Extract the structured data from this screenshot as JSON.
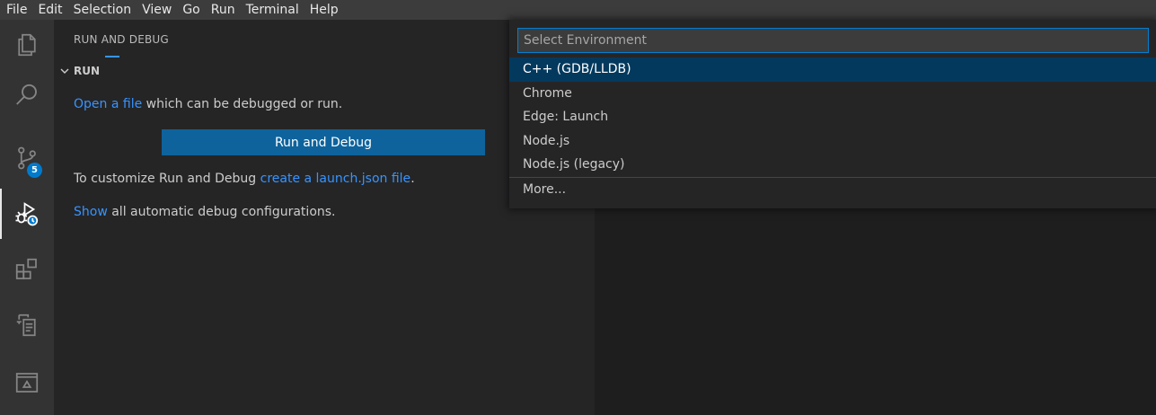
{
  "menubar": [
    "File",
    "Edit",
    "Selection",
    "View",
    "Go",
    "Run",
    "Terminal",
    "Help"
  ],
  "activitybar": {
    "items": [
      {
        "name": "explorer",
        "icon": "files-icon"
      },
      {
        "name": "search",
        "icon": "search-icon"
      },
      {
        "name": "source-control",
        "icon": "source-control-icon",
        "badge": "5"
      },
      {
        "name": "run-and-debug",
        "icon": "run-debug-icon",
        "active": true
      },
      {
        "name": "extensions",
        "icon": "extensions-icon"
      },
      {
        "name": "remote-explorer",
        "icon": "remote-explorer-icon"
      },
      {
        "name": "terminal-panel",
        "icon": "terminal-icon"
      }
    ]
  },
  "sidebar": {
    "title": "RUN AND DEBUG",
    "section": "RUN",
    "open_link": "Open a file",
    "open_rest": " which can be debugged or run.",
    "run_button": "Run and Debug",
    "customize_prefix": "To customize Run and Debug ",
    "customize_link": "create a launch.json file",
    "customize_suffix": ".",
    "show_link": "Show",
    "show_rest": " all automatic debug configurations."
  },
  "quickpick": {
    "placeholder": "Select Environment",
    "items": [
      {
        "label": "C++ (GDB/LLDB)",
        "selected": true
      },
      {
        "label": "Chrome"
      },
      {
        "label": "Edge: Launch"
      },
      {
        "label": "Node.js"
      },
      {
        "label": "Node.js (legacy)"
      }
    ],
    "more": "More..."
  },
  "colors": {
    "accent": "#007acc",
    "link": "#3794ff",
    "button": "#0e639c",
    "selection": "#04395e"
  }
}
